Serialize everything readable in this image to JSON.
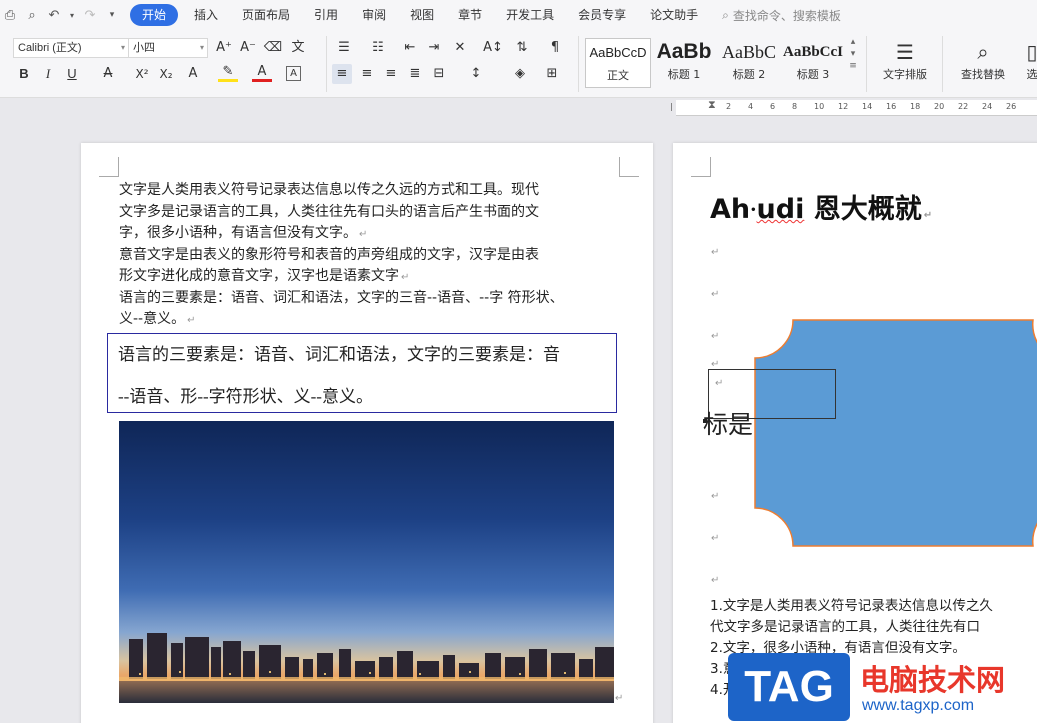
{
  "menubar": {
    "tabs": [
      "开始",
      "插入",
      "页面布局",
      "引用",
      "审阅",
      "视图",
      "章节",
      "开发工具",
      "会员专享",
      "论文助手"
    ],
    "active_tab": "开始",
    "search_placeholder": "查找命令、搜索模板"
  },
  "ribbon": {
    "font_name": "Calibri (正文)",
    "font_size": "小四",
    "styles": [
      {
        "sample": "AaBbCcD",
        "label": "正文"
      },
      {
        "sample": "AaBb",
        "label": "标题 1"
      },
      {
        "sample": "AaBbC",
        "label": "标题 2"
      },
      {
        "sample": "AaBbCcI",
        "label": "标题 3"
      }
    ],
    "text_layout_label": "文字排版",
    "find_replace_label": "查找替换",
    "select_label": "选"
  },
  "ruler": {
    "ticks": [
      "2",
      "4",
      "6",
      "8",
      "10",
      "12",
      "14",
      "16",
      "18",
      "20",
      "22",
      "24",
      "26"
    ]
  },
  "page1": {
    "paragraphs": [
      "文字是人类用表义符号记录表达信息以传之久远的方式和工具。现代",
      "文字多是记录语言的工具，人类往往先有口头的语言后产生书面的文",
      "字，很多小语种，有语言但没有文字。",
      "意音文字是由表义的象形符号和表音的声旁组成的文字，汉字是由表",
      "形文字进化成的意音文字，汉字也是语素文字",
      "语言的三要素是：语音、词汇和语法，文字的三音--语音、--字 符形状、",
      "义--意义。"
    ],
    "textbox_lines": [
      "语言的三要素是：语音、词汇和语法，文字的三要素是：音",
      "--语音、形--字符形状、义--意义。"
    ]
  },
  "page2": {
    "heading": "Ah·udi 恩大概就",
    "heading_prefix": "Ah",
    "heading_mid": "udi",
    "heading_suffix": " 恩大概就",
    "shape_text": "标是",
    "list_lines": [
      "1.文字是人类用表义符号记录表达信息以传之久",
      "代文字多是记录语言的工具，人类往往先有口",
      "2.文字，很多小语种，有语言但没有文字。",
      "3.意",
      "4.开"
    ]
  },
  "watermark": {
    "logo": "TAG",
    "title": "电脑技术网",
    "url": "www.tagxp.com"
  },
  "colors": {
    "accent": "#2f6fe4",
    "shape_fill": "#5b9bd5",
    "shape_border": "#ed7d31",
    "textbox_border": "#2a2aa0",
    "watermark_red": "#e8372b"
  }
}
